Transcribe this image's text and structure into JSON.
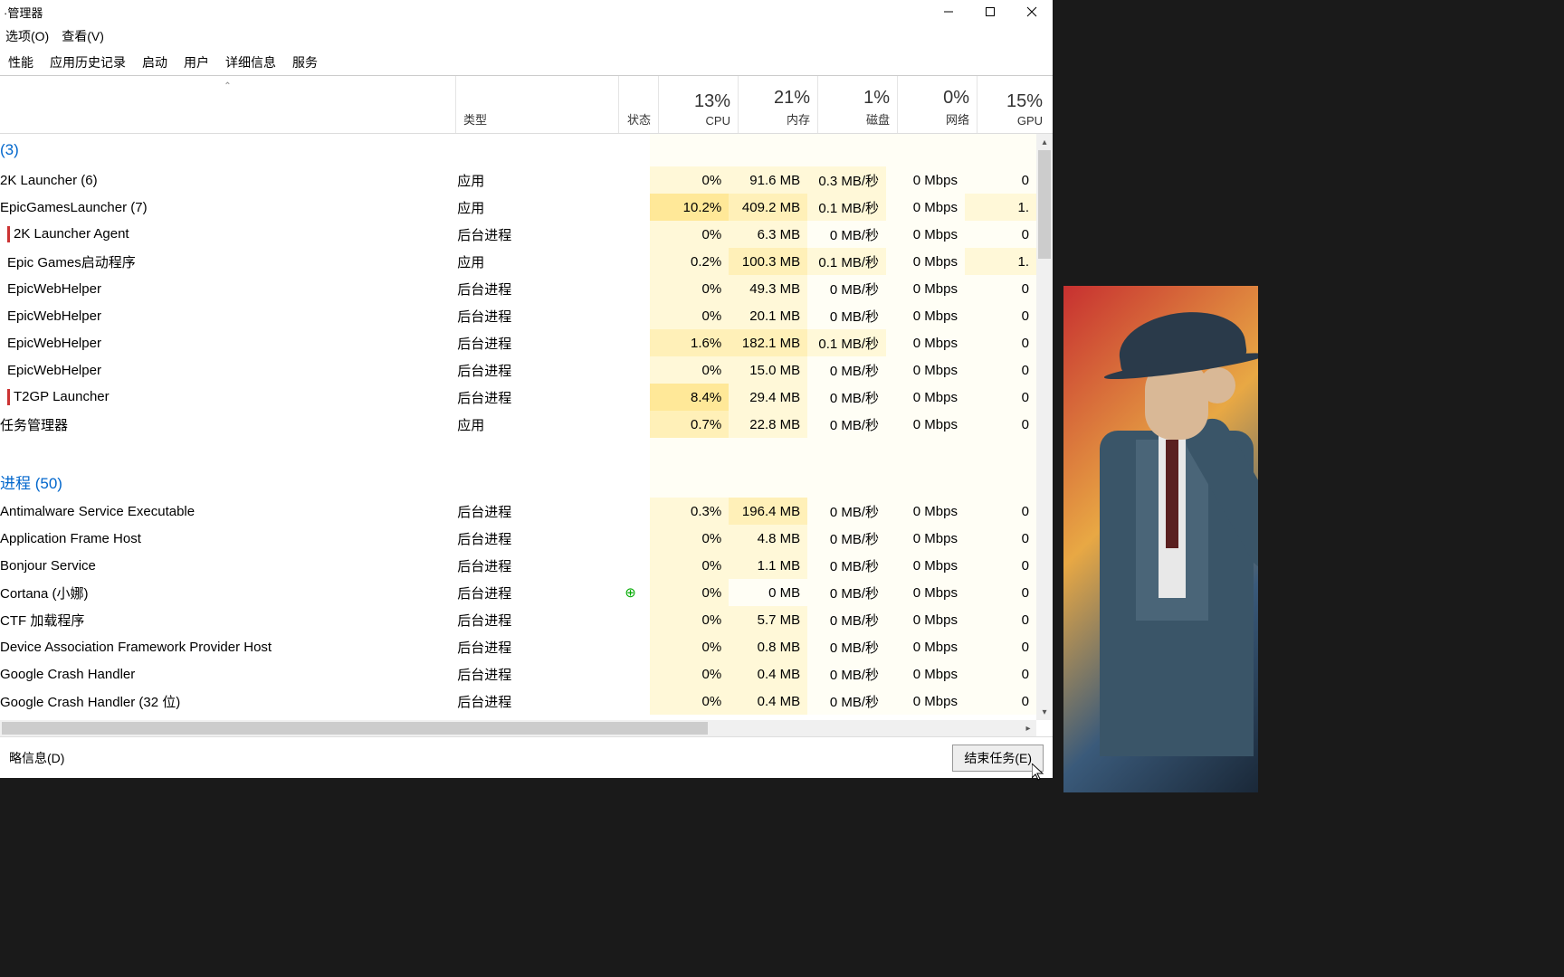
{
  "window": {
    "title": "·管理器",
    "menu": {
      "options": "选项(O)",
      "view": "查看(V)"
    },
    "tabs": [
      "性能",
      "应用历史记录",
      "启动",
      "用户",
      "详细信息",
      "服务"
    ]
  },
  "headers": {
    "type": "类型",
    "state": "状态",
    "cpu": {
      "pct": "13%",
      "lbl": "CPU"
    },
    "mem": {
      "pct": "21%",
      "lbl": "内存"
    },
    "disk": {
      "pct": "1%",
      "lbl": "磁盘"
    },
    "net": {
      "pct": "0%",
      "lbl": "网络"
    },
    "gpu": {
      "pct": "15%",
      "lbl": "GPU"
    }
  },
  "groups": {
    "apps": "(3)",
    "bg": "进程 (50)"
  },
  "rows": [
    {
      "name": "2K Launcher (6)",
      "type": "应用",
      "cpu": "0%",
      "mem": "91.6 MB",
      "disk": "0.3 MB/秒",
      "net": "0 Mbps",
      "gpu": "0",
      "cpuH": 1,
      "memH": 1,
      "diskH": 1,
      "netH": 0,
      "gpuH": 0
    },
    {
      "name": "EpicGamesLauncher (7)",
      "type": "应用",
      "cpu": "10.2%",
      "mem": "409.2 MB",
      "disk": "0.1 MB/秒",
      "net": "0 Mbps",
      "gpu": "1.",
      "cpuH": 3,
      "memH": 2,
      "diskH": 1,
      "netH": 0,
      "gpuH": 1
    },
    {
      "name": "2K Launcher Agent",
      "type": "后台进程",
      "cpu": "0%",
      "mem": "6.3 MB",
      "disk": "0 MB/秒",
      "net": "0 Mbps",
      "gpu": "0",
      "indent": 1,
      "chip": "#c33",
      "cpuH": 1,
      "memH": 1,
      "diskH": 0,
      "netH": 0,
      "gpuH": 0
    },
    {
      "name": "Epic Games启动程序",
      "type": "应用",
      "cpu": "0.2%",
      "mem": "100.3 MB",
      "disk": "0.1 MB/秒",
      "net": "0 Mbps",
      "gpu": "1.",
      "indent": 1,
      "cpuH": 1,
      "memH": 2,
      "diskH": 1,
      "netH": 0,
      "gpuH": 1
    },
    {
      "name": "EpicWebHelper",
      "type": "后台进程",
      "cpu": "0%",
      "mem": "49.3 MB",
      "disk": "0 MB/秒",
      "net": "0 Mbps",
      "gpu": "0",
      "indent": 1,
      "cpuH": 1,
      "memH": 1,
      "diskH": 0,
      "netH": 0,
      "gpuH": 0
    },
    {
      "name": "EpicWebHelper",
      "type": "后台进程",
      "cpu": "0%",
      "mem": "20.1 MB",
      "disk": "0 MB/秒",
      "net": "0 Mbps",
      "gpu": "0",
      "indent": 1,
      "cpuH": 1,
      "memH": 1,
      "diskH": 0,
      "netH": 0,
      "gpuH": 0
    },
    {
      "name": "EpicWebHelper",
      "type": "后台进程",
      "cpu": "1.6%",
      "mem": "182.1 MB",
      "disk": "0.1 MB/秒",
      "net": "0 Mbps",
      "gpu": "0",
      "indent": 1,
      "cpuH": 2,
      "memH": 2,
      "diskH": 1,
      "netH": 0,
      "gpuH": 0
    },
    {
      "name": "EpicWebHelper",
      "type": "后台进程",
      "cpu": "0%",
      "mem": "15.0 MB",
      "disk": "0 MB/秒",
      "net": "0 Mbps",
      "gpu": "0",
      "indent": 1,
      "cpuH": 1,
      "memH": 1,
      "diskH": 0,
      "netH": 0,
      "gpuH": 0
    },
    {
      "name": "T2GP Launcher",
      "type": "后台进程",
      "cpu": "8.4%",
      "mem": "29.4 MB",
      "disk": "0 MB/秒",
      "net": "0 Mbps",
      "gpu": "0",
      "indent": 1,
      "chip": "#c33",
      "cpuH": 3,
      "memH": 1,
      "diskH": 0,
      "netH": 0,
      "gpuH": 0
    },
    {
      "name": "任务管理器",
      "type": "应用",
      "cpu": "0.7%",
      "mem": "22.8 MB",
      "disk": "0 MB/秒",
      "net": "0 Mbps",
      "gpu": "0",
      "cpuH": 2,
      "memH": 1,
      "diskH": 0,
      "netH": 0,
      "gpuH": 0
    },
    {
      "name": "Antimalware Service Executable",
      "type": "后台进程",
      "cpu": "0.3%",
      "mem": "196.4 MB",
      "disk": "0 MB/秒",
      "net": "0 Mbps",
      "gpu": "0",
      "cpuH": 1,
      "memH": 2,
      "diskH": 0,
      "netH": 0,
      "gpuH": 0
    },
    {
      "name": "Application Frame Host",
      "type": "后台进程",
      "cpu": "0%",
      "mem": "4.8 MB",
      "disk": "0 MB/秒",
      "net": "0 Mbps",
      "gpu": "0",
      "cpuH": 1,
      "memH": 1,
      "diskH": 0,
      "netH": 0,
      "gpuH": 0
    },
    {
      "name": "Bonjour Service",
      "type": "后台进程",
      "cpu": "0%",
      "mem": "1.1 MB",
      "disk": "0 MB/秒",
      "net": "0 Mbps",
      "gpu": "0",
      "cpuH": 1,
      "memH": 1,
      "diskH": 0,
      "netH": 0,
      "gpuH": 0
    },
    {
      "name": "Cortana (小娜)",
      "type": "后台进程",
      "cpu": "0%",
      "mem": "0 MB",
      "disk": "0 MB/秒",
      "net": "0 Mbps",
      "gpu": "0",
      "state": "⊕",
      "cpuH": 1,
      "memH": 0,
      "diskH": 0,
      "netH": 0,
      "gpuH": 0
    },
    {
      "name": "CTF 加载程序",
      "type": "后台进程",
      "cpu": "0%",
      "mem": "5.7 MB",
      "disk": "0 MB/秒",
      "net": "0 Mbps",
      "gpu": "0",
      "cpuH": 1,
      "memH": 1,
      "diskH": 0,
      "netH": 0,
      "gpuH": 0
    },
    {
      "name": "Device Association Framework Provider Host",
      "type": "后台进程",
      "cpu": "0%",
      "mem": "0.8 MB",
      "disk": "0 MB/秒",
      "net": "0 Mbps",
      "gpu": "0",
      "cpuH": 1,
      "memH": 1,
      "diskH": 0,
      "netH": 0,
      "gpuH": 0
    },
    {
      "name": "Google Crash Handler",
      "type": "后台进程",
      "cpu": "0%",
      "mem": "0.4 MB",
      "disk": "0 MB/秒",
      "net": "0 Mbps",
      "gpu": "0",
      "cpuH": 1,
      "memH": 1,
      "diskH": 0,
      "netH": 0,
      "gpuH": 0
    },
    {
      "name": "Google Crash Handler (32 位)",
      "type": "后台进程",
      "cpu": "0%",
      "mem": "0.4 MB",
      "disk": "0 MB/秒",
      "net": "0 Mbps",
      "gpu": "0",
      "cpuH": 1,
      "memH": 1,
      "diskH": 0,
      "netH": 0,
      "gpuH": 0
    }
  ],
  "footer": {
    "details": "略信息(D)",
    "end": "结束任务(E)"
  }
}
